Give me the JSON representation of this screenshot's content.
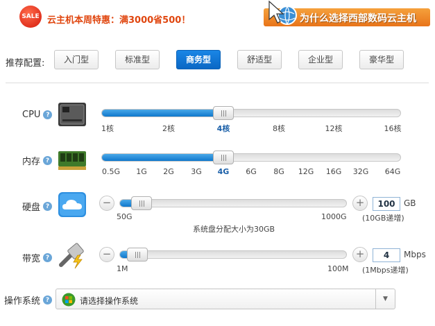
{
  "promo": {
    "badge": "SALE",
    "text": "云主机本周特惠：满3000省500！"
  },
  "banner": {
    "text": "为什么选择西部数码云主机"
  },
  "presets": {
    "label": "推荐配置:",
    "items": [
      "入门型",
      "标准型",
      "商务型",
      "舒适型",
      "企业型",
      "豪华型"
    ],
    "active": "商务型"
  },
  "cpu": {
    "label": "CPU",
    "ticks": [
      "1核",
      "2核",
      "4核",
      "8核",
      "12核",
      "16核"
    ],
    "selected": "4核"
  },
  "memory": {
    "label": "内存",
    "ticks": [
      "0.5G",
      "1G",
      "2G",
      "3G",
      "4G",
      "6G",
      "8G",
      "12G",
      "16G",
      "32G",
      "64G"
    ],
    "selected": "4G"
  },
  "disk": {
    "label": "硬盘",
    "min_label": "50G",
    "max_label": "1000G",
    "value": "100",
    "unit": "GB",
    "step_note": "(10GB递增)",
    "system_note": "系统盘分配大小为30GB",
    "level": 0.05
  },
  "bandwidth": {
    "label": "带宽",
    "min_label": "1M",
    "max_label": "100M",
    "value": "4",
    "unit": "Mbps",
    "step_note": "(1Mbps递增)",
    "level": 0.03
  },
  "os": {
    "label": "操作系统",
    "placeholder": "请选择操作系统"
  },
  "help_glyph": "?",
  "colors": {
    "accent": "#0f78cc",
    "promo": "#e0460f",
    "banner": "#e8741a"
  }
}
